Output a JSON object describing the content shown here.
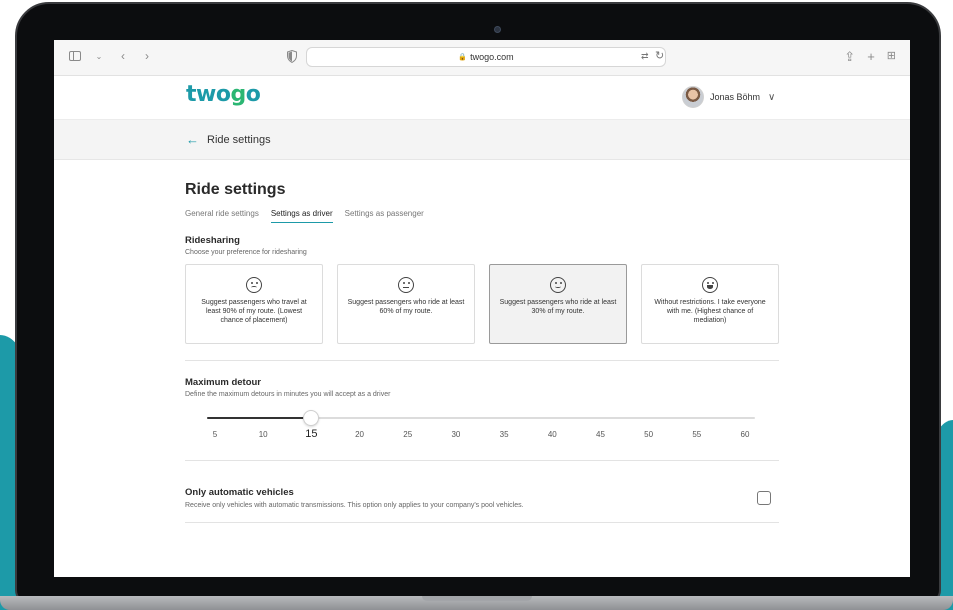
{
  "browser": {
    "url": "twogo.com"
  },
  "header": {
    "logo": "twogo",
    "user_name": "Jonas Böhm"
  },
  "breadcrumb": {
    "label": "Ride settings"
  },
  "page": {
    "title": "Ride settings",
    "tabs": [
      {
        "label": "General ride settings",
        "active": false
      },
      {
        "label": "Settings as driver",
        "active": true
      },
      {
        "label": "Settings as passenger",
        "active": false
      }
    ]
  },
  "ridesharing": {
    "title": "Ridesharing",
    "description": "Choose your preference for ridesharing",
    "options": [
      {
        "icon": "sad-face-icon",
        "text": "Suggest passengers who travel at least 90% of my route. (Lowest chance of placement)",
        "selected": false
      },
      {
        "icon": "neutral-face-icon",
        "text": "Suggest passengers who ride at least 60% of my route.",
        "selected": false
      },
      {
        "icon": "smile-face-icon",
        "text": "Suggest passengers who ride at least 30% of my route.",
        "selected": true
      },
      {
        "icon": "grin-face-icon",
        "text": "Without restrictions. I take everyone with me. (Highest chance of mediation)",
        "selected": false
      }
    ]
  },
  "detour": {
    "title": "Maximum detour",
    "description": "Define the maximum detours in minutes you will accept as a driver",
    "ticks": [
      "5",
      "10",
      "15",
      "20",
      "25",
      "30",
      "35",
      "40",
      "45",
      "50",
      "55",
      "60"
    ],
    "selected_value": 15,
    "min": 5,
    "max": 60
  },
  "automatic": {
    "title": "Only automatic vehicles",
    "description": "Receive only vehicles with automatic transmissions. This option only applies to your company's pool vehicles.",
    "checked": false
  },
  "colors": {
    "accent": "#1d9aa8",
    "logo_green": "#2bb673"
  }
}
